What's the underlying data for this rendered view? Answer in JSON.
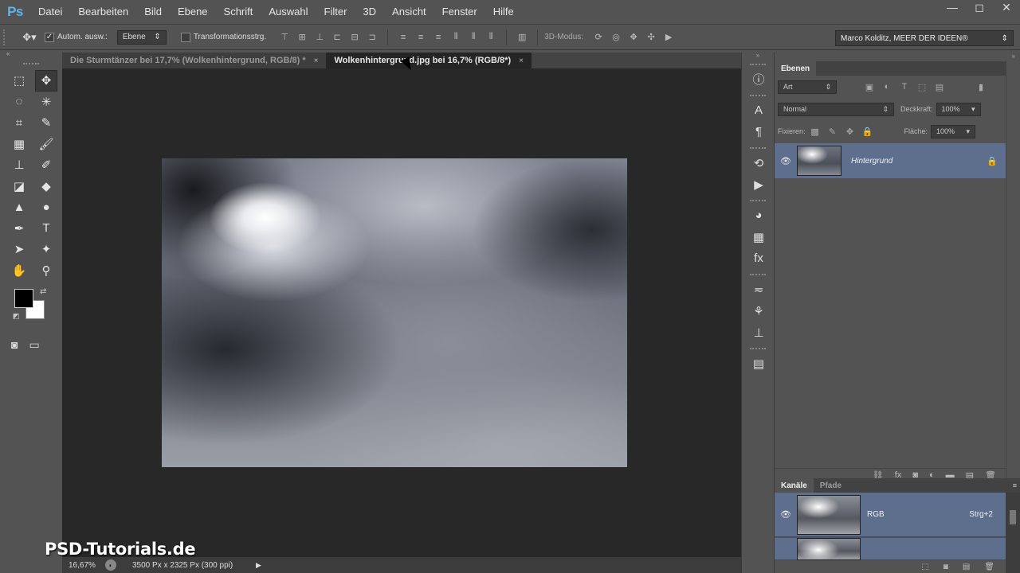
{
  "app": {
    "logo": "Ps"
  },
  "menu": [
    "Datei",
    "Bearbeiten",
    "Bild",
    "Ebene",
    "Schrift",
    "Auswahl",
    "Filter",
    "3D",
    "Ansicht",
    "Fenster",
    "Hilfe"
  ],
  "window_controls": {
    "minimize": "—",
    "maximize": "◻",
    "close": "✕"
  },
  "options": {
    "auto_select_label": "Autom. ausw.:",
    "auto_select_checked": true,
    "auto_select_value": "Ebene",
    "transform_label": "Transformationsstrg.",
    "transform_checked": false,
    "mode3d_label": "3D-Modus:",
    "workspace": "Marco Kolditz, MEER DER IDEEN®"
  },
  "documents": {
    "tabs": [
      {
        "label": "Die Sturmtänzer bei 17,7% (Wolkenhintergrund, RGB/8) *",
        "close": "×",
        "active": false
      },
      {
        "label": "Wolkenhintergrund.jpg bei 16,7% (RGB/8*)",
        "close": "×",
        "active": true
      }
    ]
  },
  "status": {
    "zoom": "16,67%",
    "docinfo": "3500 Px x 2325 Px (300 ppi)",
    "arrow": "▶"
  },
  "watermark": "PSD-Tutorials.de",
  "layers_panel": {
    "tab": "Ebenen",
    "filter_kind": "Art",
    "blend_mode": "Normal",
    "opacity_label": "Deckkraft:",
    "opacity_value": "100%",
    "lock_label": "Fixieren:",
    "fill_label": "Fläche:",
    "fill_value": "100%",
    "layers": [
      {
        "name": "Hintergrund",
        "visible": true,
        "locked": true
      }
    ]
  },
  "channels_panel": {
    "tabs": [
      "Kanäle",
      "Pfade"
    ],
    "channels": [
      {
        "name": "RGB",
        "shortcut": "Strg+2"
      },
      {
        "name": "",
        "shortcut": ""
      }
    ]
  },
  "colors": {
    "foreground": "#000000",
    "background": "#ffffff",
    "selection": "#5e6f8e"
  }
}
